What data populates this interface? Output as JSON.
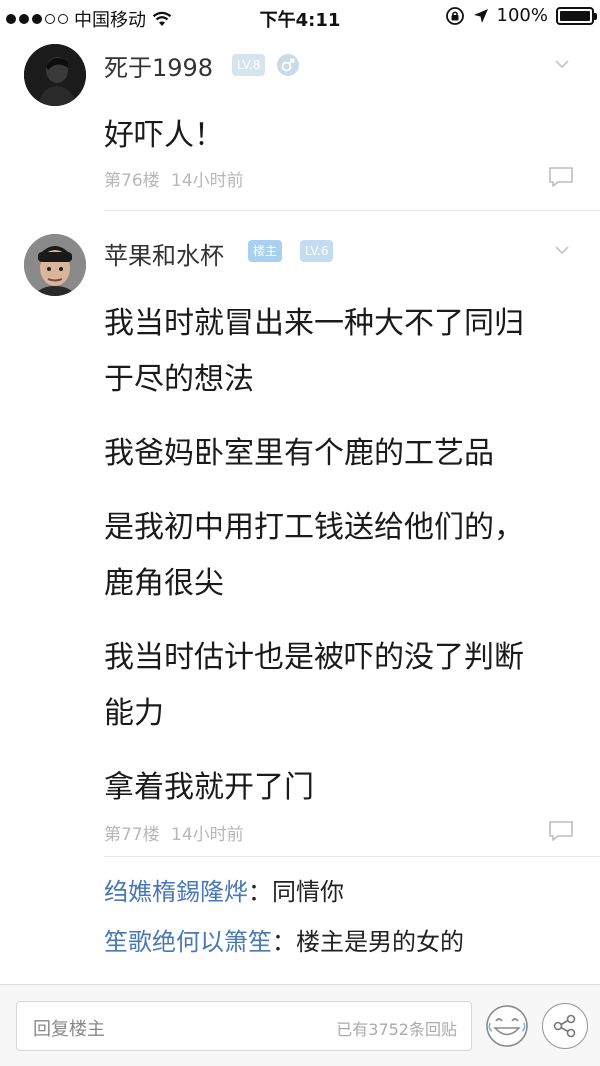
{
  "status_bar": {
    "carrier": "中国移动",
    "time": "下午4:11",
    "battery": "100%"
  },
  "posts": [
    {
      "author": "死于1998",
      "badge_level": "LV.8",
      "gender_icon": "male-icon",
      "lines": [
        "好吓人！"
      ],
      "floor": "第76楼",
      "time": "14小时前"
    },
    {
      "author": "苹果和水杯",
      "badge_owner": "楼主",
      "badge_level": "LV.6",
      "lines": [
        "我当时就冒出来一种大不了同归",
        "于尽的想法",
        "我爸妈卧室里有个鹿的工艺品",
        "是我初中用打工钱送给他们的，",
        "鹿角很尖",
        "我当时估计也是被吓的没了判断",
        "能力",
        "拿着我就开了门"
      ],
      "floor": "第77楼",
      "time": "14小时前",
      "replies": [
        {
          "name": "绉嫶楕錫隆烨",
          "text": "：同情你"
        },
        {
          "name": "笙歌绝何以箫笙",
          "text": "：楼主是男的女的"
        }
      ]
    }
  ],
  "bottom_bar": {
    "reply_placeholder": "回复楼主",
    "reply_count": "已有3752条回贴"
  },
  "colors": {
    "accent_blue": "#4a78b5",
    "meta_gray": "#b8b8b8",
    "badge_blue": "#a9d0f0"
  }
}
